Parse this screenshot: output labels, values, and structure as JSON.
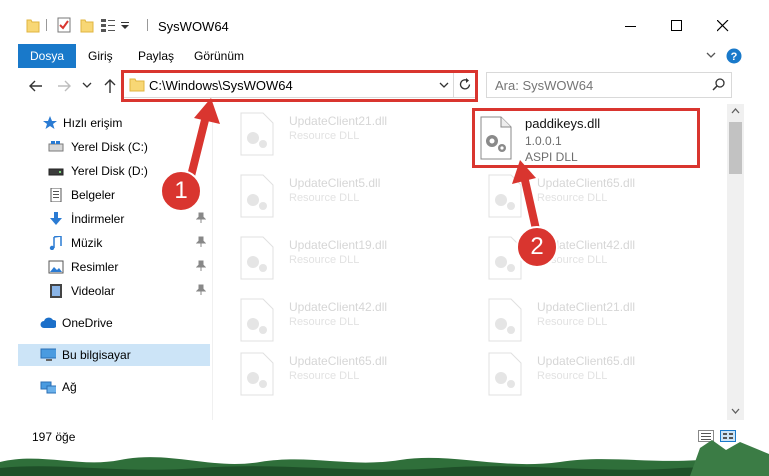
{
  "window": {
    "title": "SysWOW64"
  },
  "ribbon": {
    "tabs": [
      {
        "label": "Dosya"
      },
      {
        "label": "Giriş"
      },
      {
        "label": "Paylaş"
      },
      {
        "label": "Görünüm"
      }
    ]
  },
  "address": {
    "path": "C:\\Windows\\SysWOW64",
    "search_placeholder": "Ara: SysWOW64"
  },
  "sidebar": {
    "items": [
      {
        "label": "Hızlı erişim"
      },
      {
        "label": "Yerel Disk (C:)"
      },
      {
        "label": "Yerel Disk (D:)"
      },
      {
        "label": "Belgeler"
      },
      {
        "label": "İndirmeler"
      },
      {
        "label": "Müzik"
      },
      {
        "label": "Resimler"
      },
      {
        "label": "Videolar"
      },
      {
        "label": "OneDrive"
      },
      {
        "label": "Bu bilgisayar"
      },
      {
        "label": "Ağ"
      }
    ]
  },
  "files": {
    "selected": {
      "name": "paddikeys.dll",
      "version": "1.0.0.1",
      "desc": "ASPI DLL"
    },
    "faded": [
      {
        "name": "UpdateClient21.dll",
        "desc": "Resource DLL"
      },
      {
        "name": "UpdateClient5.dll",
        "desc": "Resource DLL"
      },
      {
        "name": "UpdateClient65.dll",
        "desc": "Resource DLL"
      },
      {
        "name": "UpdateClient19.dll",
        "desc": "Resource DLL"
      },
      {
        "name": "UpdateClient42.dll",
        "desc": "Resource DLL"
      },
      {
        "name": "UpdateClient42.dll",
        "desc": "Resource DLL"
      },
      {
        "name": "UpdateClient21.dll",
        "desc": "Resource DLL"
      },
      {
        "name": "UpdateClient65.dll",
        "desc": "Resource DLL"
      },
      {
        "name": "UpdateClient65.dll",
        "desc": "Resource DLL"
      }
    ]
  },
  "status": {
    "count": "197 öğe"
  },
  "annotations": {
    "badge1": "1",
    "badge2": "2"
  },
  "colors": {
    "accent": "#1979ca",
    "highlight_red": "#d9352f",
    "selected_nav": "#cce4f7"
  }
}
